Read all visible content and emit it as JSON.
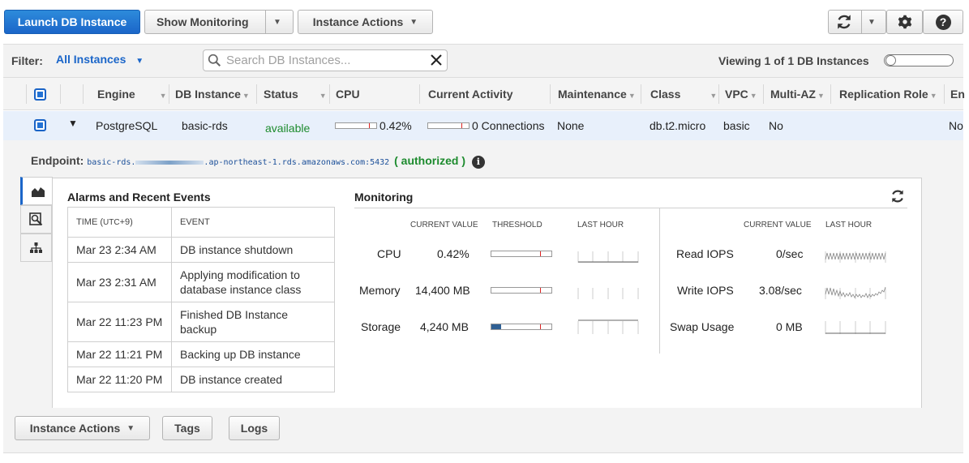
{
  "toolbar": {
    "launch_label": "Launch DB Instance",
    "show_monitoring_label": "Show Monitoring",
    "instance_actions_label": "Instance Actions"
  },
  "filter": {
    "label": "Filter:",
    "value": "All Instances",
    "search_placeholder": "Search DB Instances...",
    "viewing_text": "Viewing 1 of 1 DB Instances"
  },
  "table": {
    "columns": [
      "Engine",
      "DB Instance",
      "Status",
      "CPU",
      "Current Activity",
      "Maintenance",
      "Class",
      "VPC",
      "Multi-AZ",
      "Replication Role",
      "En"
    ],
    "row": {
      "engine": "PostgreSQL",
      "db_instance": "basic-rds",
      "status": "available",
      "cpu_text": "0.42%",
      "cpu_fraction": 0.0042,
      "activity_text": "0 Connections",
      "maintenance": "None",
      "class": "db.t2.micro",
      "vpc": "basic",
      "multi_az": "No",
      "replication_role": "",
      "extra": "No"
    }
  },
  "detail": {
    "endpoint_label": "Endpoint:",
    "endpoint_prefix": "basic-rds.",
    "endpoint_suffix": ".ap-northeast-1.rds.amazonaws.com:5432",
    "paren_open": "(",
    "authorized": "authorized",
    "paren_close": ")",
    "alarms_title": "Alarms and Recent Events",
    "time_header_a": "TIME (",
    "time_header_b": "UTC",
    "time_header_c": "+9)",
    "event_header": "EVENT",
    "events": [
      {
        "time": "Mar 23 2:34 AM",
        "event": "DB instance shutdown"
      },
      {
        "time": "Mar 23 2:31 AM",
        "event": "Applying modification to database instance class"
      },
      {
        "time": "Mar 22 11:23 PM",
        "event": "Finished DB Instance backup"
      },
      {
        "time": "Mar 22 11:21 PM",
        "event": "Backing up DB instance"
      },
      {
        "time": "Mar 22 11:20 PM",
        "event": "DB instance created"
      }
    ],
    "monitoring_title": "Monitoring",
    "headers": {
      "current_value": "CURRENT VALUE",
      "threshold": "THRESHOLD",
      "last_hour": "LAST HOUR"
    },
    "metrics_left": [
      {
        "name": "CPU",
        "value": "0.42%",
        "fill_fraction": 0.0042
      },
      {
        "name": "Memory",
        "value": "14,400 MB",
        "fill_fraction": 0.0
      },
      {
        "name": "Storage",
        "value": "4,240 MB",
        "fill_fraction": 0.16
      }
    ],
    "metrics_right": [
      {
        "name": "Read IOPS",
        "value": "0/sec"
      },
      {
        "name": "Write IOPS",
        "value": "3.08/sec"
      },
      {
        "name": "Swap Usage",
        "value": "0 MB"
      }
    ]
  },
  "bottom": {
    "instance_actions_label": "Instance Actions",
    "tags_label": "Tags",
    "logs_label": "Logs"
  }
}
